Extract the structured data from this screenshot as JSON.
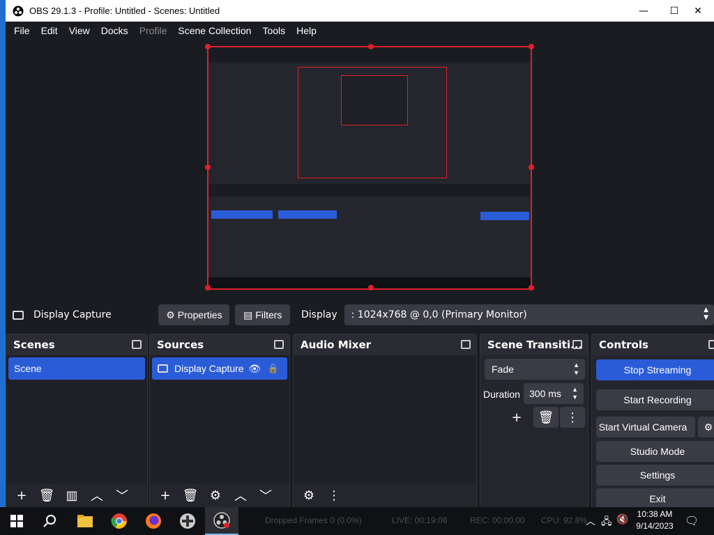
{
  "window": {
    "title": "OBS 29.1.3 - Profile: Untitled - Scenes: Untitled",
    "minimize": "—",
    "maximize": "☐",
    "close": "✕"
  },
  "menu": [
    "File",
    "Edit",
    "View",
    "Docks",
    "Profile",
    "Scene Collection",
    "Tools",
    "Help"
  ],
  "source_toolbar": {
    "source_name": "Display Capture",
    "properties_label": "Properties",
    "filters_label": "Filters",
    "display_label": "Display",
    "display_value": ": 1024x768 @ 0,0 (Primary Monitor)"
  },
  "docks": {
    "scenes": {
      "title": "Scenes",
      "items": [
        "Scene"
      ]
    },
    "sources": {
      "title": "Sources",
      "items": [
        "Display Capture"
      ]
    },
    "audio_mixer": {
      "title": "Audio Mixer"
    },
    "transitions": {
      "title": "Scene Transiti...",
      "selected": "Fade",
      "duration_label": "Duration",
      "duration_value": "300 ms"
    },
    "controls": {
      "title": "Controls",
      "stop_streaming": "Stop Streaming",
      "start_recording": "Start Recording",
      "start_virtual_camera": "Start Virtual Camera",
      "studio_mode": "Studio Mode",
      "settings": "Settings",
      "exit": "Exit"
    }
  },
  "statusbar": {
    "dropped_frames": "Dropped Frames 0 (0.0%)",
    "live": "LIVE: 00:19:08",
    "rec": "REC: 00:00:00",
    "cpu": "CPU: 92.8%"
  },
  "taskbar": {
    "time": "10:38 AM",
    "date": "9/14/2023"
  },
  "colors": {
    "accent": "#2b5cd8",
    "selection_border": "#e0202a",
    "background": "#1b1c22"
  }
}
